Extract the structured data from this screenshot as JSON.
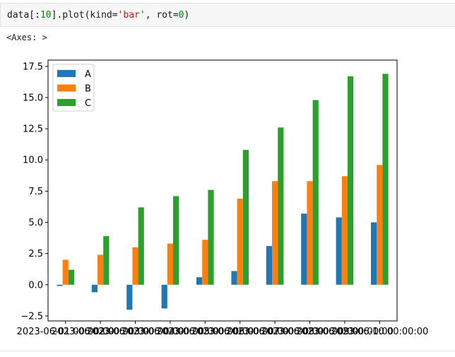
{
  "cell": {
    "code_prefix": "data[:",
    "code_num1": "10",
    "code_mid": "].plot(kind=",
    "code_str": "'bar'",
    "code_mid2": ", rot=",
    "code_num2": "0",
    "code_suffix": ")"
  },
  "output_text": "<Axes: >",
  "chart_data": {
    "type": "bar",
    "categories": [
      "2023-06-01 00:00:00",
      "2023-06-02 00:00:00",
      "2023-06-03 00:00:00",
      "2023-06-04 00:00:00",
      "2023-06-05 00:00:00",
      "2023-06-06 00:00:00",
      "2023-06-07 00:00:00",
      "2023-06-08 00:00:00",
      "2023-06-09 00:00:00",
      "2023-06-10 00:00:00"
    ],
    "series": [
      {
        "name": "A",
        "color": "#1f77b4",
        "values": [
          -0.1,
          -0.6,
          -2.0,
          -1.9,
          0.6,
          1.1,
          3.1,
          5.7,
          5.4,
          5.0
        ]
      },
      {
        "name": "B",
        "color": "#ff7f0e",
        "values": [
          2.0,
          2.4,
          3.0,
          3.3,
          3.6,
          6.9,
          8.3,
          8.3,
          8.7,
          9.6
        ]
      },
      {
        "name": "C",
        "color": "#2ca02c",
        "values": [
          1.2,
          3.9,
          6.2,
          7.1,
          7.6,
          10.8,
          12.6,
          14.8,
          16.7,
          16.9
        ]
      }
    ],
    "yticks": [
      "−2.5",
      "0.0",
      "2.5",
      "5.0",
      "7.5",
      "10.0",
      "12.5",
      "15.0",
      "17.5"
    ],
    "ylim": [
      -2.9,
      18.0
    ],
    "legend_location": "upper left",
    "title": "",
    "xlabel": "",
    "ylabel": ""
  }
}
